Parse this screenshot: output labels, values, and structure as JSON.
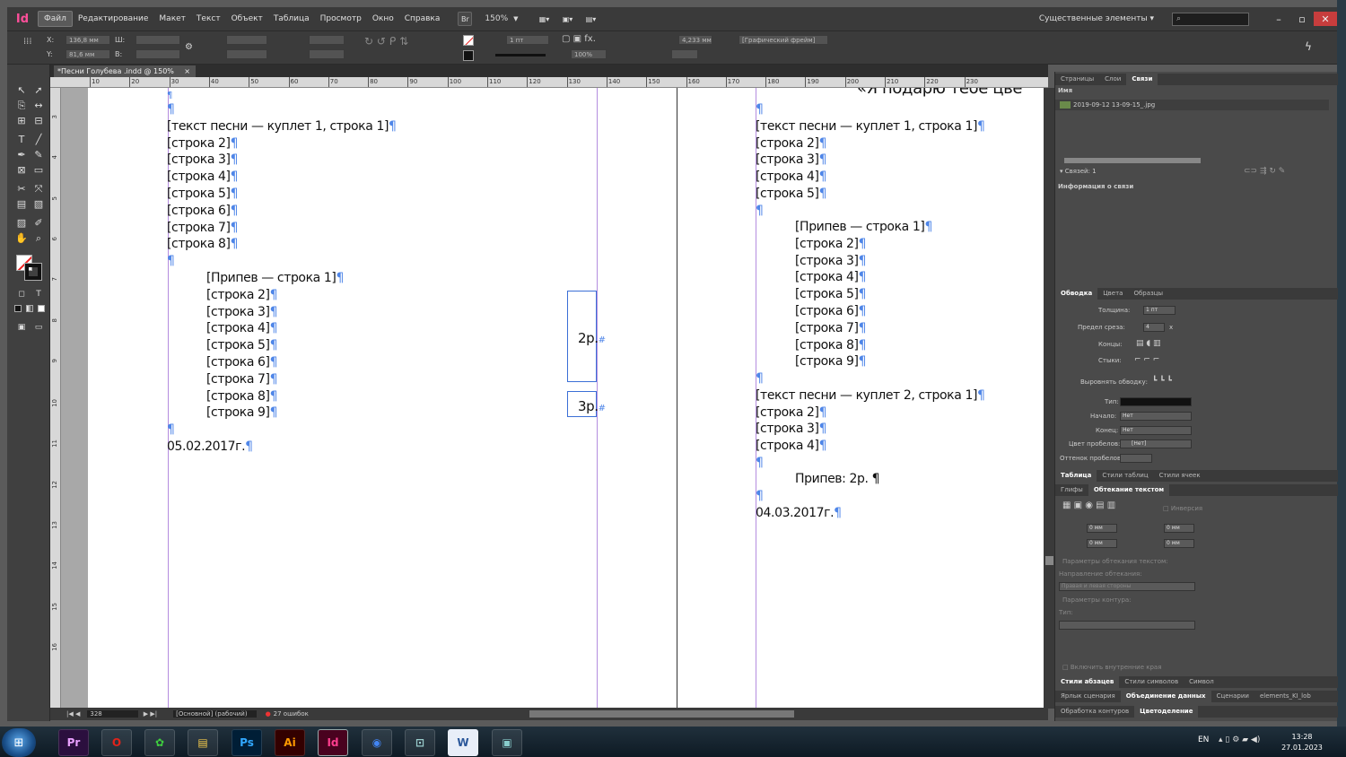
{
  "menubar": {
    "app_logo": "Id",
    "items": [
      "Файл",
      "Редактирование",
      "Макет",
      "Текст",
      "Объект",
      "Таблица",
      "Просмотр",
      "Окно",
      "Справка"
    ],
    "bridge": "Br",
    "zoom": "150%",
    "workspace": "Существенные элементы",
    "search_placeholder": ""
  },
  "control": {
    "x_label": "X:",
    "x_value": "136,8 мм",
    "y_label": "Y:",
    "y_value": "81,6 мм",
    "w_label": "Ш:",
    "h_label": "В:",
    "stroke_weight": "1 пт",
    "dimension": "4,233 мм",
    "frame_type": "[Графический фрейм]",
    "opacity": "100%",
    "fx": "fx."
  },
  "tab": {
    "title": "*Песни Голубева .indd @ 150%",
    "close": "×"
  },
  "ruler": {
    "h_ticks": [
      "10",
      "20",
      "30",
      "40",
      "50",
      "60",
      "70",
      "80",
      "90",
      "100",
      "110",
      "120",
      "130",
      "140",
      "150",
      "160",
      "170",
      "180",
      "190",
      "200",
      "210",
      "220",
      "230"
    ],
    "v_ticks": [
      "3",
      "4",
      "5",
      "6",
      "7",
      "8",
      "9",
      "10",
      "11",
      "12",
      "13",
      "14",
      "15",
      "16"
    ]
  },
  "page1": {
    "lines": [
      "¶",
      "[текст песни — куплет 1, строка 1]¶",
      "[строка 2]¶",
      "[строка 3]¶",
      "[строка 4]¶",
      "[строка 5]¶",
      "[строка 6]¶",
      "[строка 7]¶",
      "[строка 8]¶",
      "¶"
    ],
    "chorus": [
      "[Припев — строка 1]¶",
      "[строка 2]¶",
      "[строка 3]¶",
      "[строка 4]¶",
      "[строка 5]¶",
      "[строка 6]¶",
      "[строка 7]¶",
      "[строка 8]¶",
      "[строка 9]¶"
    ],
    "end": [
      "¶",
      "05.02.2017г.¶"
    ],
    "frame1_text": "2р.",
    "frame2_text": "3р."
  },
  "page2": {
    "title_fragment": "«Я подарю тебе цве",
    "verse1": [
      "¶",
      "[текст песни — куплет 1, строка 1]¶",
      "[строка 2]¶",
      "[строка 3]¶",
      "[строка 4]¶",
      "[строка 5]¶",
      "¶"
    ],
    "chorus": [
      "[Припев — строка 1]¶",
      "[строка 2]¶",
      "[строка 3]¶",
      "[строка 4]¶",
      "[строка 5]¶",
      "[строка 6]¶",
      "[строка 7]¶",
      "[строка 8]¶",
      "[строка 9]¶"
    ],
    "verse2": [
      "¶",
      "[текст песни — куплет 2, строка 1]¶",
      "[строка 2]¶",
      "[строка 3]¶",
      "[строка 4]¶",
      "¶"
    ],
    "chorus_ref": "Припев: 2р. ¶",
    "end": [
      "¶",
      "04.03.2017г.¶"
    ]
  },
  "status": {
    "page": "328",
    "style": "[Основной] (рабочий)",
    "errors": "27 ошибок"
  },
  "panels": {
    "top_tabs": [
      "Страницы",
      "Слои",
      "Связи"
    ],
    "links_header": "Имя",
    "link_file": "2019-09-12 13-09-15_.jpg",
    "links_count": "Связей: 1",
    "link_info": "Информация о связи",
    "stroke_tabs": [
      "Обводка",
      "Цвета",
      "Образцы"
    ],
    "stroke_weight_label": "Толщина:",
    "stroke_weight_value": "1 пт",
    "miter_label": "Предел среза:",
    "miter_value": "4",
    "miter_unit": "x",
    "cap_label": "Концы:",
    "join_label": "Стыки:",
    "align_label": "Выровнять обводку:",
    "type_label": "Тип:",
    "start_label": "Начало:",
    "start_value": "Нет",
    "end_label": "Конец:",
    "end_value": "Нет",
    "gap_color_label": "Цвет пробелов:",
    "gap_color_value": "[Нет]",
    "gap_tint_label": "Оттенок пробелов:",
    "table_tabs": [
      "Таблица",
      "Стили таблиц",
      "Стили ячеек"
    ],
    "wrap_tabs": [
      "Глифы",
      "Обтекание текстом"
    ],
    "invert": "Инверсия",
    "mm0": "0 мм",
    "wrap_options": "Параметры обтекания текстом:",
    "wrap_direction": "Направление обтекания:",
    "wrap_sides": "Правая и левая стороны",
    "contour_options": "Параметры контура:",
    "contour_type": "Тип:",
    "inner_edges": "Включить внутренние края",
    "bottom_tabs1": [
      "Стили абзацев",
      "Стили символов",
      "Символ"
    ],
    "bottom_tabs2": [
      "Ярлык сценария",
      "Объединение данных",
      "Сценарии",
      "elements_KI_lob"
    ],
    "bottom_tabs3": [
      "Обработка контуров",
      "Цветоделение"
    ]
  },
  "taskbar": {
    "apps": [
      "Pr",
      "",
      "",
      "",
      "Ps",
      "Ai",
      "Id",
      "",
      "",
      "W",
      ""
    ],
    "lang": "EN",
    "time": "13:28",
    "date": "27.01.2023"
  },
  "colors": {
    "indesign_pink": "#ff3e8f",
    "margin_purple": "#b48ddf",
    "pilcrow_blue": "#4f86e8"
  }
}
